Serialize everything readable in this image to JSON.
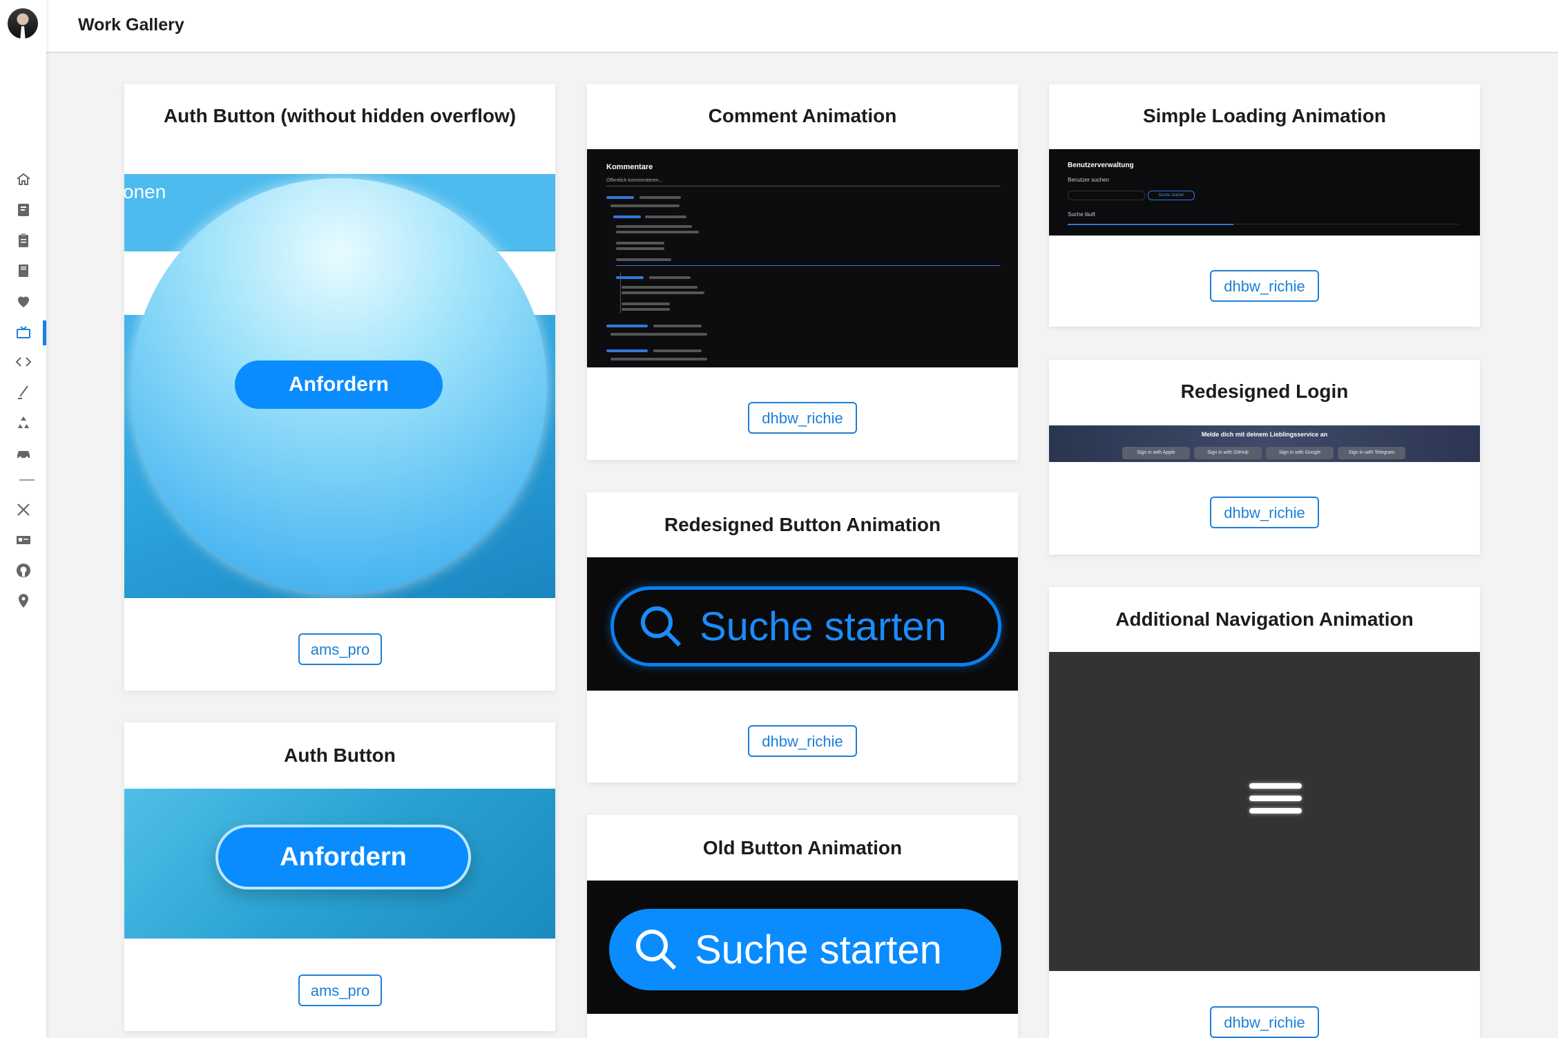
{
  "header": {
    "title": "Work Gallery"
  },
  "sidebar": {
    "active_item": "gallery",
    "items": [
      {
        "icon": "home-icon"
      },
      {
        "icon": "resume-icon"
      },
      {
        "icon": "clipboard-icon"
      },
      {
        "icon": "book-icon"
      },
      {
        "icon": "heart-icon"
      },
      {
        "icon": "gallery-icon"
      },
      {
        "icon": "code-icon"
      },
      {
        "icon": "pen-icon"
      },
      {
        "icon": "recycle-icon"
      },
      {
        "icon": "car-icon"
      },
      {
        "icon": "tools-icon"
      },
      {
        "icon": "id-card-icon"
      },
      {
        "icon": "github-icon"
      },
      {
        "icon": "location-pin-icon"
      }
    ]
  },
  "cards": {
    "auth_overflow": {
      "title": "Auth Button (without hidden overflow)",
      "preview_text": "onen",
      "button_text": "Anfordern",
      "author": "ams_pro"
    },
    "auth": {
      "title": "Auth Button",
      "button_text": "Anfordern",
      "author": "ams_pro"
    },
    "comment": {
      "title": "Comment Animation",
      "heading": "Kommentare",
      "placeholder": "Öffentlich kommentieren...",
      "author": "dhbw_richie"
    },
    "redesigned_button": {
      "title": "Redesigned Button Animation",
      "search_text": "Suche starten",
      "author": "dhbw_richie"
    },
    "old_button": {
      "title": "Old Button Animation",
      "search_text": "Suche starten"
    },
    "loading": {
      "title": "Simple Loading Animation",
      "heading": "Benutzerverwaltung",
      "label": "Benutzer suchen",
      "button": "Suche starten",
      "status": "Suche läuft",
      "author": "dhbw_richie"
    },
    "login": {
      "title": "Redesigned Login",
      "prompt": "Melde dich mit deinem Lieblingsservice an",
      "buttons": [
        "Sign in with Apple",
        "Sign in with GitHub",
        "Sign in with Google",
        "Sign in with Telegram"
      ],
      "author": "dhbw_richie"
    },
    "navigation": {
      "title": "Additional Navigation Animation",
      "author": "dhbw_richie"
    }
  },
  "colors": {
    "accent": "#1c7fd8",
    "button_blue": "#0a8cff"
  }
}
